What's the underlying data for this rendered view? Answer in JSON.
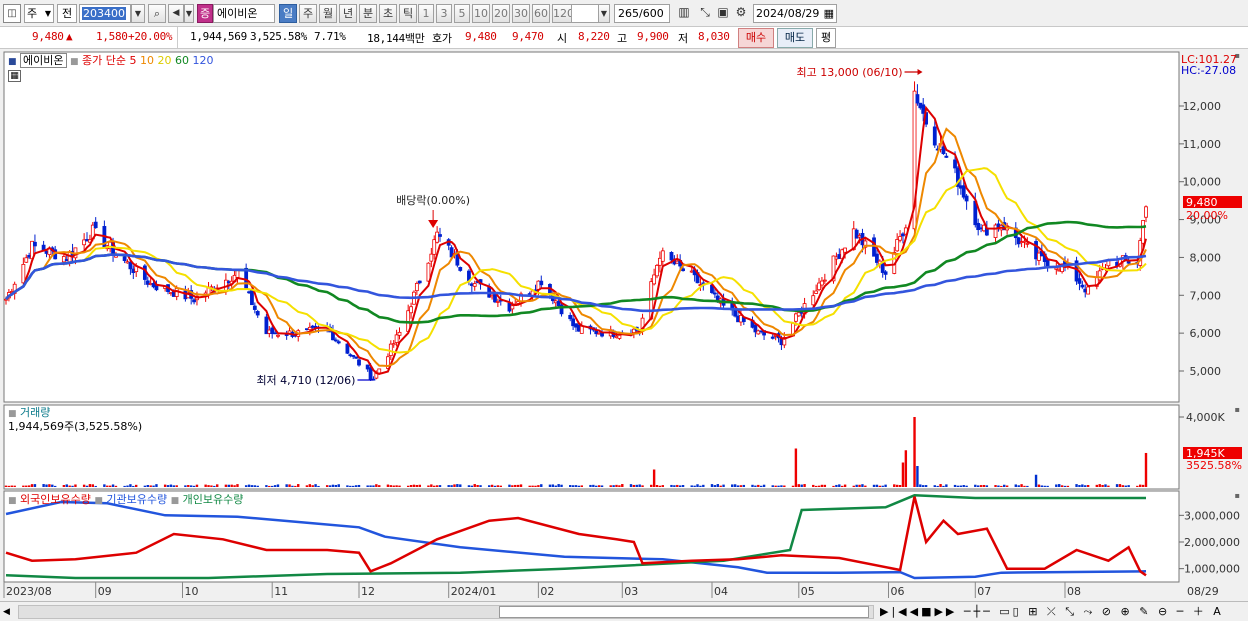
{
  "toolbar": {
    "period_options": [
      "주",
      "전"
    ],
    "period_selected": "주",
    "compare_label": "전",
    "code": "203400",
    "stock_name": "에이비온",
    "stock_badge": "증",
    "tabs": [
      "일",
      "주",
      "월",
      "년",
      "분",
      "초",
      "틱"
    ],
    "tab_selected": "일",
    "intervals": [
      "1",
      "3",
      "5",
      "10",
      "20",
      "30",
      "60",
      "120"
    ],
    "count_value": "265",
    "count_total": "/600",
    "date": "2024/08/29"
  },
  "quote": {
    "price": "9,480",
    "change_symbol": "▲",
    "change": "1,580",
    "change_pct": "+20.00%",
    "volume": "1,944,569",
    "volume_ratio": "3,525.58%",
    "turnover": "7.71%",
    "amount": "18,144백만",
    "bid_label": "호가",
    "ask_price": "9,480",
    "bid_price": "9,470",
    "open_label": "시",
    "open": "8,220",
    "high_label": "고",
    "high": "9,900",
    "low_label": "저",
    "low": "8,030",
    "buy_button": "매수",
    "sell_button": "매도",
    "eval_button": "평"
  },
  "chart_data": [
    {
      "type": "candlestick",
      "title": "에이비온",
      "legend": {
        "price_label": "종가 단순",
        "periods": [
          "5",
          "10",
          "20",
          "60",
          "120"
        ],
        "colors": {
          "5": "#dd0000",
          "10": "#ee8800",
          "20": "#f5e000",
          "60": "#118822",
          "120": "#3355dd"
        }
      },
      "y_ticks": [
        5000,
        6000,
        7000,
        8000,
        9000,
        10000,
        11000,
        12000
      ],
      "y_tick_labels": [
        "5,000",
        "6,000",
        "7,000",
        "8,000",
        "9,000",
        "10,000",
        "11,000",
        "12,000"
      ],
      "ylim": [
        4300,
        13400
      ],
      "lc_label": "LC:101.27",
      "hc_label": "HC:-27.08",
      "current_price_label": "9,480",
      "current_pct_label": "20.00%",
      "annotations": {
        "high": "최고 13,000 (06/10)",
        "low": "최저 4,710 (12/06)",
        "dividend": "배당락(0.00%)"
      },
      "close_trend": [
        [
          "2023-08-01",
          6900
        ],
        [
          "2023-08-10",
          8300
        ],
        [
          "2023-08-22",
          8000
        ],
        [
          "2023-08-31",
          8700
        ],
        [
          "2023-09-08",
          8100
        ],
        [
          "2023-09-20",
          7300
        ],
        [
          "2023-10-05",
          6900
        ],
        [
          "2023-10-20",
          7600
        ],
        [
          "2023-10-30",
          6000
        ],
        [
          "2023-11-10",
          6000
        ],
        [
          "2023-11-20",
          6100
        ],
        [
          "2023-12-06",
          4800
        ],
        [
          "2023-12-15",
          6000
        ],
        [
          "2023-12-28",
          8600
        ],
        [
          "2024-01-10",
          7300
        ],
        [
          "2024-01-22",
          6700
        ],
        [
          "2024-02-02",
          7400
        ],
        [
          "2024-02-14",
          6100
        ],
        [
          "2024-02-26",
          6000
        ],
        [
          "2024-03-07",
          6100
        ],
        [
          "2024-03-14",
          8100
        ],
        [
          "2024-03-25",
          7500
        ],
        [
          "2024-04-05",
          6700
        ],
        [
          "2024-04-17",
          6000
        ],
        [
          "2024-04-25",
          5800
        ],
        [
          "2024-05-07",
          7200
        ],
        [
          "2024-05-20",
          8700
        ],
        [
          "2024-05-31",
          7600
        ],
        [
          "2024-06-07",
          8900
        ],
        [
          "2024-06-10",
          12400
        ],
        [
          "2024-06-14",
          11600
        ],
        [
          "2024-06-24",
          10200
        ],
        [
          "2024-07-03",
          8700
        ],
        [
          "2024-07-10",
          8900
        ],
        [
          "2024-07-22",
          8000
        ],
        [
          "2024-08-02",
          7700
        ],
        [
          "2024-08-09",
          7100
        ],
        [
          "2024-08-16",
          7900
        ],
        [
          "2024-08-26",
          7900
        ],
        [
          "2024-08-29",
          9480
        ]
      ]
    },
    {
      "type": "bar",
      "title": "거래량",
      "value_label": "1,944,569주(3,525.58%)",
      "y_tick_labels": [
        "4,000K"
      ],
      "current_label": "1,945K",
      "current_pct_label": "3525.58%",
      "spikes": [
        [
          "2024-03-12",
          1000
        ],
        [
          "2024-04-30",
          2200
        ],
        [
          "2024-06-06",
          1400
        ],
        [
          "2024-06-07",
          2100
        ],
        [
          "2024-06-10",
          4000
        ],
        [
          "2024-06-11",
          1200
        ],
        [
          "2024-07-22",
          700
        ],
        [
          "2024-08-29",
          1945
        ]
      ]
    },
    {
      "type": "line",
      "series": [
        {
          "name": "외국인보유수량",
          "color": "#dd0000"
        },
        {
          "name": "기관보유수량",
          "color": "#2255dd"
        },
        {
          "name": "개인보유수량",
          "color": "#118844"
        }
      ],
      "y_tick_labels": [
        "1,000,000",
        "2,000,000",
        "3,000,000"
      ],
      "ylim": [
        500000,
        3800000
      ]
    }
  ],
  "x_axis": {
    "labels": [
      "2023/08",
      "09",
      "10",
      "11",
      "12",
      "2024/01",
      "02",
      "03",
      "04",
      "05",
      "06",
      "07",
      "08"
    ],
    "end_label": "08/29"
  }
}
